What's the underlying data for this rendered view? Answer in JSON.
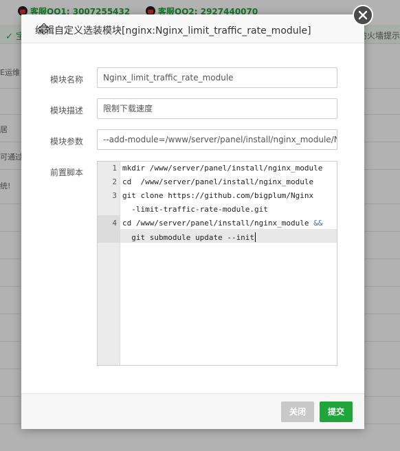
{
  "background": {
    "qq1_label": "客服QQ1: 3007255432",
    "qq2_label": "客服QQ2: 2927440070",
    "notice_left": "✓ 宝",
    "notice_right": "防火墙提示",
    "left_fragments": [
      "E运维",
      "居",
      "可通过",
      "统!"
    ]
  },
  "dialog": {
    "title": "编辑自定义选装模块[nginx:Nginx_limit_traffic_rate_module]",
    "fields": {
      "name_label": "模块名称",
      "name_value": "Nginx_limit_traffic_rate_module",
      "desc_label": "模块描述",
      "desc_value": "限制下载速度",
      "params_label": "模块参数",
      "params_value": "--add-module=/www/server/panel/install/nginx_module/N",
      "script_label": "前置脚本"
    },
    "script": {
      "line_numbers": [
        "1",
        "2",
        "3",
        "4"
      ],
      "lines": [
        "mkdir /www/server/panel/install/nginx_module",
        "cd  /www/server/panel/install/nginx_module",
        "git clone https://github.com/bigplum/Nginx",
        "  -limit-traffic-rate-module.git",
        "cd /www/server/panel/install/nginx_module ",
        "&&",
        "  git submodule update --init"
      ]
    },
    "buttons": {
      "close": "关闭",
      "submit": "提交"
    }
  }
}
